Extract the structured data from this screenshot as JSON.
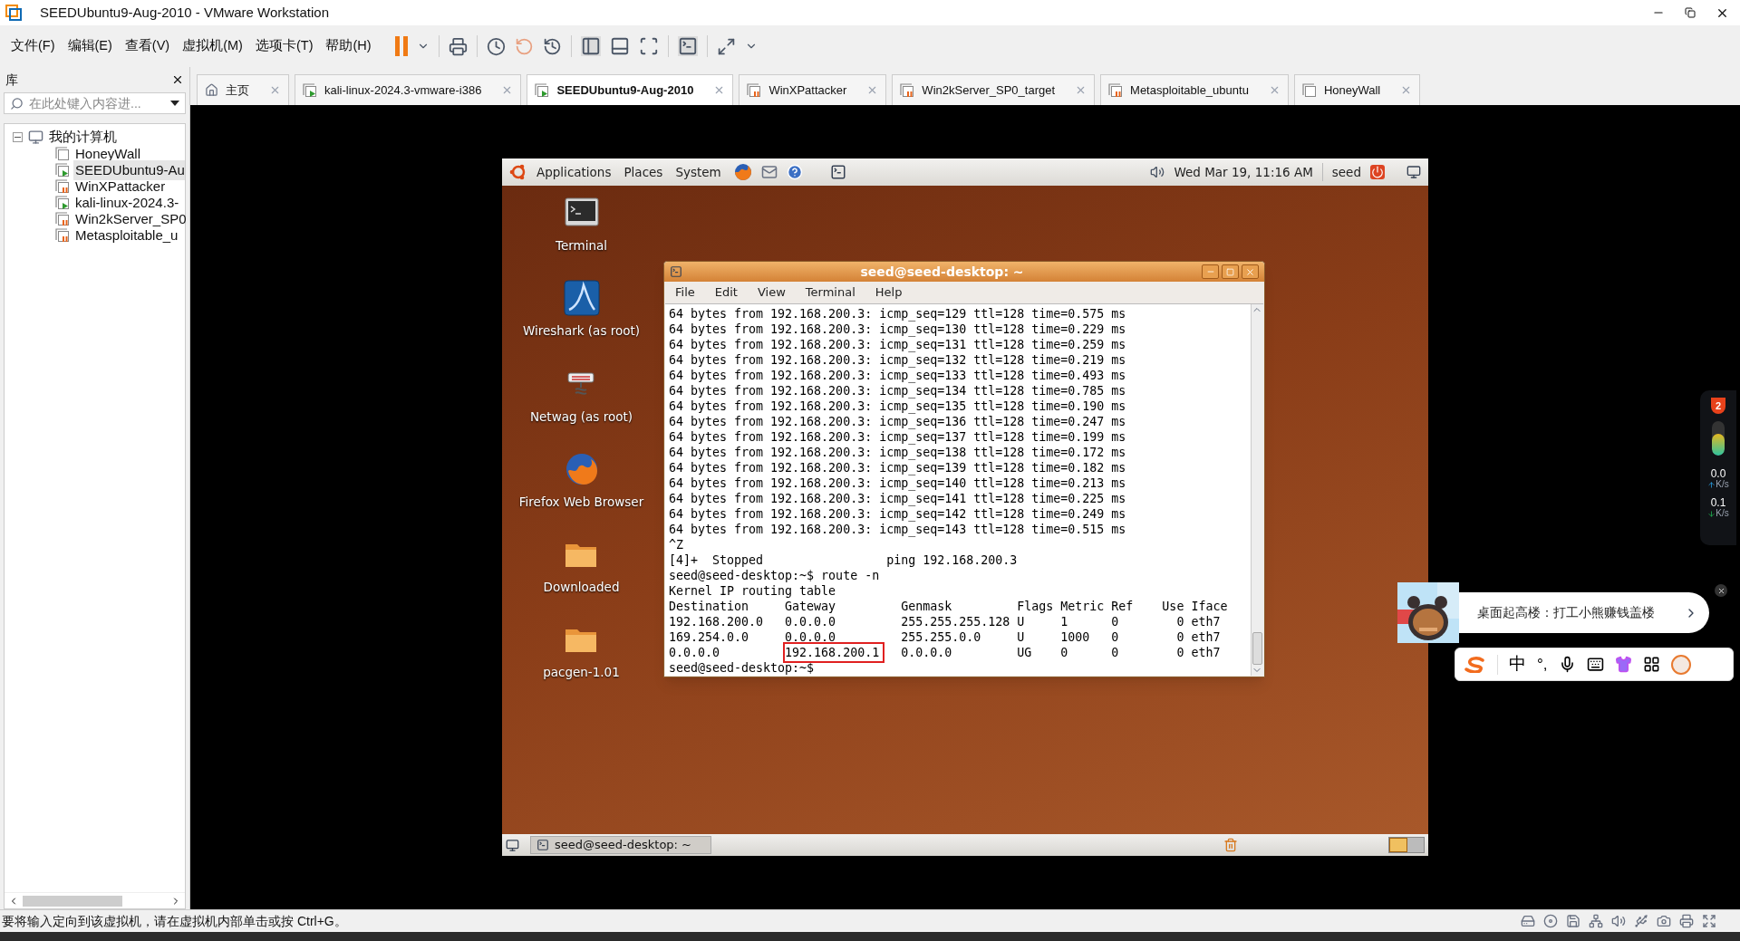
{
  "window": {
    "title": "SEEDUbuntu9-Aug-2010 - VMware Workstation"
  },
  "menu": [
    "文件(F)",
    "编辑(E)",
    "查看(V)",
    "虚拟机(M)",
    "选项卡(T)",
    "帮助(H)"
  ],
  "library": {
    "title": "库",
    "search": {
      "placeholder": "在此处键入内容进..."
    },
    "tree": [
      {
        "label": "我的计算机",
        "expanded": true,
        "selected": false,
        "children": [
          {
            "label": "HoneyWall",
            "kind": "off",
            "selected": false
          },
          {
            "label": "SEEDUbuntu9-Au",
            "kind": "running",
            "selected": true
          },
          {
            "label": "WinXPattacker",
            "kind": "paused",
            "selected": false
          },
          {
            "label": "kali-linux-2024.3-",
            "kind": "running",
            "selected": false
          },
          {
            "label": "Win2kServer_SP0",
            "kind": "paused",
            "selected": false
          },
          {
            "label": "Metasploitable_u",
            "kind": "paused",
            "selected": false
          }
        ]
      }
    ]
  },
  "tabs": [
    {
      "label": "主页",
      "kind": "home",
      "selected": false
    },
    {
      "label": "kali-linux-2024.3-vmware-i386",
      "kind": "running",
      "selected": false
    },
    {
      "label": "SEEDUbuntu9-Aug-2010",
      "kind": "running",
      "selected": true
    },
    {
      "label": "WinXPattacker",
      "kind": "paused",
      "selected": false
    },
    {
      "label": "Win2kServer_SP0_target",
      "kind": "paused",
      "selected": false
    },
    {
      "label": "Metasploitable_ubuntu",
      "kind": "paused",
      "selected": false
    },
    {
      "label": "HoneyWall",
      "kind": "off",
      "selected": false
    }
  ],
  "guest": {
    "panel": {
      "menus": [
        "Applications",
        "Places",
        "System"
      ],
      "clock": "Wed Mar 19, 11:16 AM",
      "user": "seed"
    },
    "desktop_icons": [
      {
        "label": "Terminal",
        "kind": "terminal"
      },
      {
        "label": "Wireshark (as root)",
        "kind": "wireshark"
      },
      {
        "label": "Netwag (as root)",
        "kind": "netwag"
      },
      {
        "label": "Firefox Web Browser",
        "kind": "firefox"
      },
      {
        "label": "Downloaded",
        "kind": "folder"
      },
      {
        "label": "pacgen-1.01",
        "kind": "folder"
      }
    ],
    "terminal": {
      "title": "seed@seed-desktop: ~",
      "menu": [
        "File",
        "Edit",
        "View",
        "Terminal",
        "Help"
      ],
      "output": [
        "64 bytes from 192.168.200.3: icmp_seq=129 ttl=128 time=0.575 ms",
        "64 bytes from 192.168.200.3: icmp_seq=130 ttl=128 time=0.229 ms",
        "64 bytes from 192.168.200.3: icmp_seq=131 ttl=128 time=0.259 ms",
        "64 bytes from 192.168.200.3: icmp_seq=132 ttl=128 time=0.219 ms",
        "64 bytes from 192.168.200.3: icmp_seq=133 ttl=128 time=0.493 ms",
        "64 bytes from 192.168.200.3: icmp_seq=134 ttl=128 time=0.785 ms",
        "64 bytes from 192.168.200.3: icmp_seq=135 ttl=128 time=0.190 ms",
        "64 bytes from 192.168.200.3: icmp_seq=136 ttl=128 time=0.247 ms",
        "64 bytes from 192.168.200.3: icmp_seq=137 ttl=128 time=0.199 ms",
        "64 bytes from 192.168.200.3: icmp_seq=138 ttl=128 time=0.172 ms",
        "64 bytes from 192.168.200.3: icmp_seq=139 ttl=128 time=0.182 ms",
        "64 bytes from 192.168.200.3: icmp_seq=140 ttl=128 time=0.213 ms",
        "64 bytes from 192.168.200.3: icmp_seq=141 ttl=128 time=0.225 ms",
        "64 bytes from 192.168.200.3: icmp_seq=142 ttl=128 time=0.249 ms",
        "64 bytes from 192.168.200.3: icmp_seq=143 ttl=128 time=0.515 ms",
        "^Z",
        "[4]+  Stopped                 ping 192.168.200.3",
        "seed@seed-desktop:~$ route -n",
        "Kernel IP routing table"
      ],
      "route_table": {
        "columns": [
          "Destination",
          "Gateway",
          "Genmask",
          "Flags",
          "Metric",
          "Ref",
          "Use",
          "Iface"
        ],
        "rows": [
          {
            "cells": [
              "192.168.200.0",
              "0.0.0.0",
              "255.255.255.128",
              "U",
              "1",
              "0",
              "0",
              "eth7"
            ],
            "gateway_marked": false
          },
          {
            "cells": [
              "169.254.0.0",
              "0.0.0.0",
              "255.255.0.0",
              "U",
              "1000",
              "0",
              "0",
              "eth7"
            ],
            "gateway_marked": false
          },
          {
            "cells": [
              "0.0.0.0",
              "192.168.200.1",
              "0.0.0.0",
              "UG",
              "0",
              "0",
              "0",
              "eth7"
            ],
            "gateway_marked": true
          }
        ]
      },
      "prompt": "seed@seed-desktop:~$"
    },
    "taskbar": {
      "window_button": "seed@seed-desktop: ~"
    }
  },
  "net_widget": {
    "badge": "2",
    "level": 0.62,
    "upload": "0.0",
    "upload_unit": "K/s",
    "download": "0.1",
    "download_unit": "K/s"
  },
  "ad": {
    "text": "桌面起高楼：打工小熊赚钱盖楼"
  },
  "ime": {
    "mode": "中",
    "punctuation": "°,"
  },
  "status_bar": {
    "text": "要将输入定向到该虚拟机，请在虚拟机内部单击或按 Ctrl+G。"
  }
}
